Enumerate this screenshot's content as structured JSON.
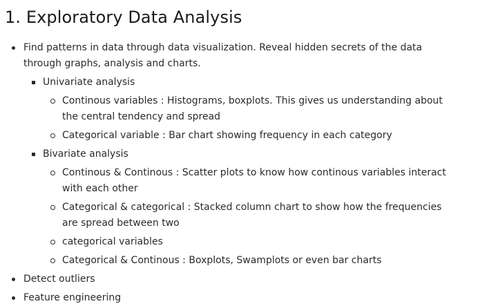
{
  "heading": "1. Exploratory Data Analysis",
  "items": {
    "patterns": "Find patterns in data through data visualization. Reveal hidden secrets of the data through graphs, analysis and charts.",
    "univariate": {
      "label": "Univariate analysis",
      "continuous": "Continous variables : Histograms, boxplots. This gives us understanding about the central tendency and spread",
      "categorical": "Categorical variable : Bar chart showing frequency in each category"
    },
    "bivariate": {
      "label": "Bivariate analysis",
      "cont_cont": "Continous & Continous : Scatter plots to know how continous variables interact with each other",
      "cat_cat": "Categorical & categorical : Stacked column chart to show how the frequencies are spread between two",
      "cat_vars": "categorical variables",
      "cat_cont": "Categorical & Continous : Boxplots, Swamplots or even bar charts"
    },
    "outliers": "Detect outliers",
    "feature": "Feature engineering"
  }
}
